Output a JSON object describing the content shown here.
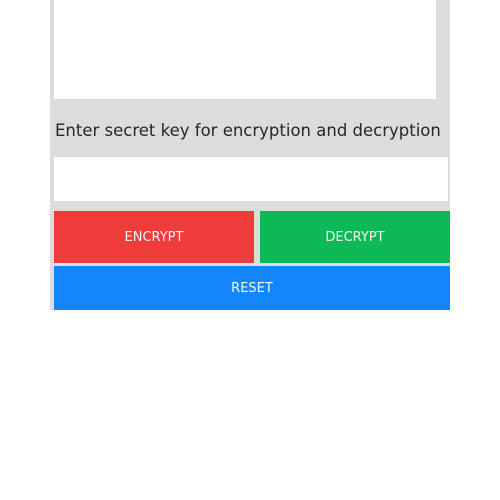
{
  "message": {
    "value": ""
  },
  "key": {
    "label": "Enter secret key for encryption and decryption",
    "value": ""
  },
  "buttons": {
    "encrypt": "ENCRYPT",
    "decrypt": "DECRYPT",
    "reset": "RESET"
  },
  "colors": {
    "encrypt": "#ef3b39",
    "decrypt": "#0cb956",
    "reset": "#1187fb",
    "panel": "#dcdcdc"
  }
}
